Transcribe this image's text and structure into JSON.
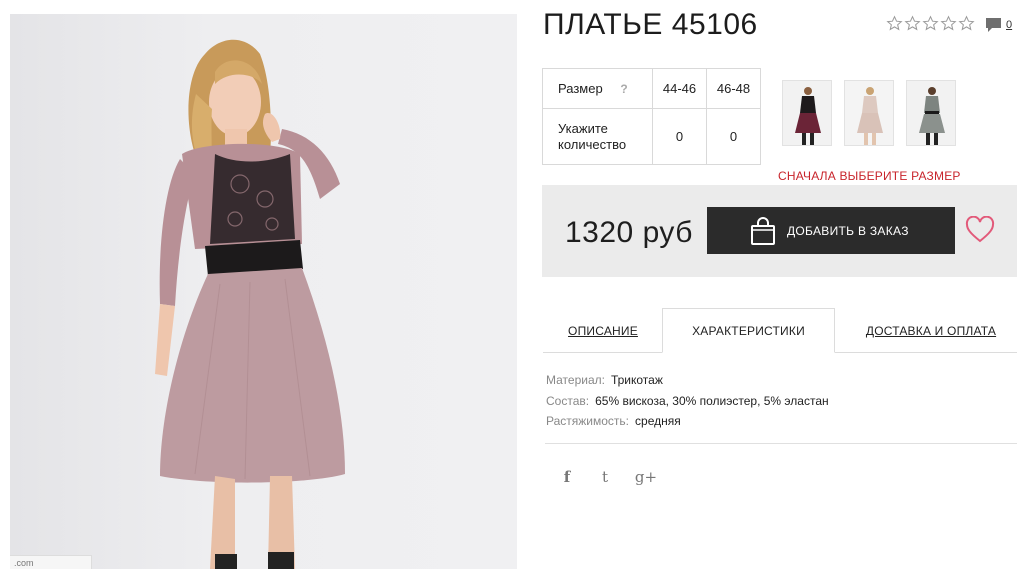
{
  "product": {
    "title": "ПЛАТЬЕ 45106",
    "rating_stars": 5,
    "comments_count": "0"
  },
  "sizes": {
    "size_label": "Размер",
    "help_icon": "?",
    "options": [
      "44-46",
      "46-48"
    ],
    "qty_label_line1": "Укажите",
    "qty_label_line2": "количество",
    "quantities": [
      "0",
      "0"
    ]
  },
  "warning_text": "СНАЧАЛА ВЫБЕРИТЕ РАЗМЕР",
  "purchase": {
    "price": "1320 руб",
    "add_to_order_label": "ДОБАВИТЬ В ЗАКАЗ"
  },
  "tabs": [
    {
      "label": "ОПИСАНИЕ"
    },
    {
      "label": "ХАРАКТЕРИСТИКИ"
    },
    {
      "label": "ДОСТАВКА И ОПЛАТА"
    }
  ],
  "specs": [
    {
      "key": "Материал:",
      "value": "Трикотаж"
    },
    {
      "key": "Состав:",
      "value": "65% вискоза, 30% полиэстер, 5% эластан"
    },
    {
      "key": "Растяжимость:",
      "value": "средняя"
    }
  ],
  "social": {
    "facebook": "f",
    "twitter": "t",
    "google_plus": "g+"
  },
  "watermark_text": ".com",
  "icons": [
    "star-icon",
    "comment-icon",
    "help-icon",
    "bag-icon",
    "heart-icon",
    "facebook-icon",
    "twitter-icon",
    "google-plus-icon"
  ],
  "colors": {
    "accent_red": "#c8242b",
    "button_dark": "#2b2b2b",
    "price_bar": "#ebebeb",
    "heart": "#e25a7a"
  }
}
